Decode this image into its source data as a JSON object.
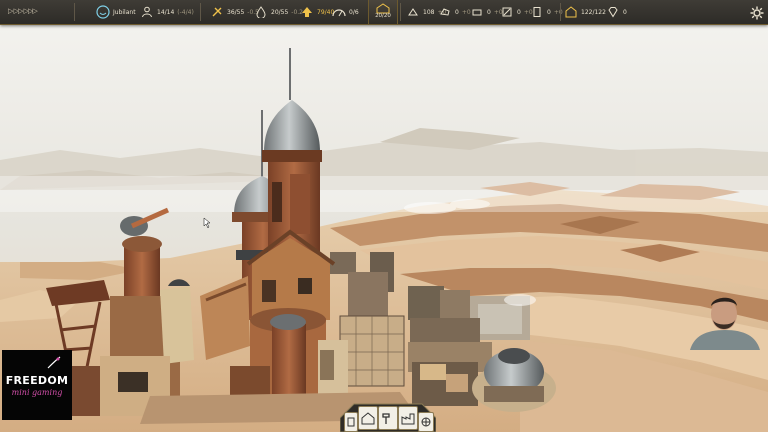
{
  "hud": {
    "speed_label": "▷ ▷▷ ▷▷▷",
    "colony_name": "Jubilant",
    "population": "14/14",
    "population_sub": "(-4/4)",
    "food": "36/55",
    "food_sub": "-0.5",
    "water": "20/55",
    "water_sub": "-0.2",
    "happiness": "79/40",
    "energy": "0/6",
    "housing": "20/20",
    "housing_sub": "+0.0",
    "res1": "108",
    "res1_sub": "+0",
    "res2": "0",
    "res2_sub": "+0",
    "res3": "0",
    "res3_sub": "+0",
    "res4": "0",
    "res4_sub": "+0",
    "res5": "0",
    "res5_sub": "+0",
    "storage": "122/122",
    "gems": "0"
  },
  "logo": {
    "line1": "FREEDOM",
    "line2": "mini gaming"
  },
  "colors": {
    "hud_bg": "#2d2b27",
    "accent": "#f0c24a",
    "logo_pink": "#d14ea8"
  },
  "icons": [
    "people-icon",
    "food-icon",
    "water-icon",
    "happiness-icon",
    "energy-icon",
    "housing-icon",
    "metal-icon",
    "stone-icon",
    "wood-icon",
    "parts-icon",
    "fuel-icon",
    "storage-icon",
    "gem-icon",
    "settings-gear-icon"
  ]
}
